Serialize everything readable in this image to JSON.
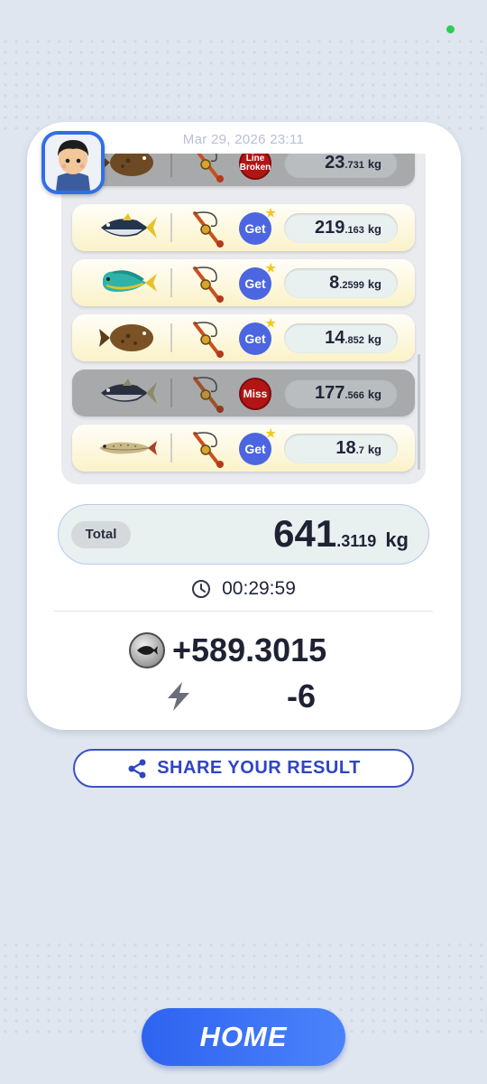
{
  "result": {
    "datetime": "Mar 29, 2026 23:11",
    "catches": [
      {
        "fish": "flounder-icon",
        "status": "broken",
        "status_label": "Line Broken",
        "weight_int": "23",
        "weight_dec": ".731",
        "unit": "kg"
      },
      {
        "fish": "tuna-icon",
        "status": "get",
        "status_label": "Get",
        "weight_int": "219",
        "weight_dec": ".163",
        "unit": "kg"
      },
      {
        "fish": "mahi-mahi-icon",
        "status": "get",
        "status_label": "Get",
        "weight_int": "8",
        "weight_dec": ".2599",
        "unit": "kg"
      },
      {
        "fish": "flounder-icon",
        "status": "get",
        "status_label": "Get",
        "weight_int": "14",
        "weight_dec": ".852",
        "unit": "kg"
      },
      {
        "fish": "tuna-icon",
        "status": "miss",
        "status_label": "Miss",
        "weight_int": "177",
        "weight_dec": ".566",
        "unit": "kg"
      },
      {
        "fish": "pike-icon",
        "status": "get",
        "status_label": "Get",
        "weight_int": "18",
        "weight_dec": ".7",
        "unit": "kg"
      }
    ],
    "total": {
      "label": "Total",
      "int": "641",
      "dec": ".3119",
      "unit": "kg"
    },
    "time": "00:29:59",
    "reward": "+589.3015",
    "energy": "-6"
  },
  "buttons": {
    "share": "SHARE YOUR RESULT",
    "home": "HOME"
  },
  "colors": {
    "accent": "#3a4fc7",
    "home": "#2e63f0",
    "get_badge": "#4b66e0",
    "miss_badge": "#b31414"
  }
}
